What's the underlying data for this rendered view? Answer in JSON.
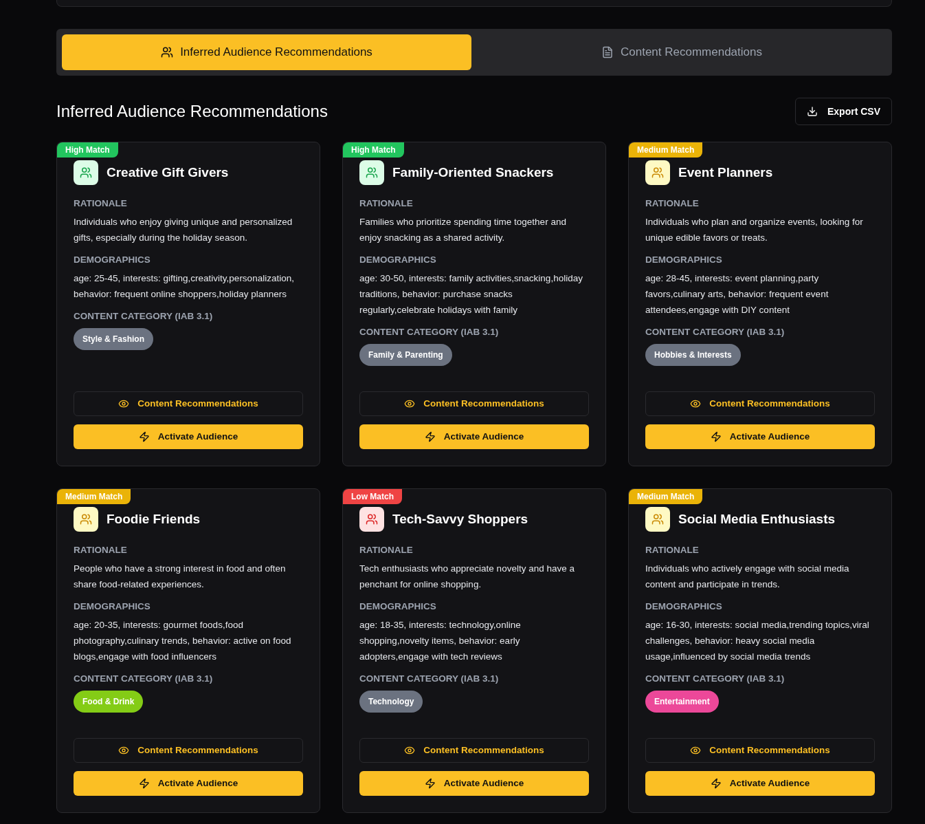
{
  "tabs": [
    {
      "label": "Inferred Audience Recommendations",
      "selected": true
    },
    {
      "label": "Content Recommendations",
      "selected": false
    }
  ],
  "heading": "Inferred Audience Recommendations",
  "export_button": "Export CSV",
  "cards": [
    {
      "kind": "high",
      "badge": "High Match",
      "title": "Creative Gift Givers",
      "labels": [
        "RATIONALE",
        "DEMOGRAPHICS",
        "CONTENT CATEGORY (IAB 3.1)"
      ],
      "rationale": "Individuals who enjoy giving unique and personalized gifts, especially during the holiday season.",
      "demographics": "age: 25-45, interests: gifting,creativity,personalization, behavior: frequent online shoppers,holiday planners",
      "category": {
        "label": "Style & Fashion",
        "color": "#6b7280"
      },
      "content_button": "Content Recommendations",
      "activate_button": "Activate Audience"
    },
    {
      "kind": "high",
      "badge": "High Match",
      "title": "Family-Oriented Snackers",
      "labels": [
        "RATIONALE",
        "DEMOGRAPHICS",
        "CONTENT CATEGORY (IAB 3.1)"
      ],
      "rationale": "Families who prioritize spending time together and enjoy snacking as a shared activity.",
      "demographics": "age: 30-50, interests: family activities,snacking,holiday traditions, behavior: purchase snacks regularly,celebrate holidays with family",
      "category": {
        "label": "Family & Parenting",
        "color": "#6b7280"
      },
      "content_button": "Content Recommendations",
      "activate_button": "Activate Audience"
    },
    {
      "kind": "medium",
      "badge": "Medium Match",
      "title": "Event Planners",
      "labels": [
        "RATIONALE",
        "DEMOGRAPHICS",
        "CONTENT CATEGORY (IAB 3.1)"
      ],
      "rationale": "Individuals who plan and organize events, looking for unique edible favors or treats.",
      "demographics": "age: 28-45, interests: event planning,party favors,culinary arts, behavior: frequent event attendees,engage with DIY content",
      "category": {
        "label": "Hobbies & Interests",
        "color": "#6b7280"
      },
      "content_button": "Content Recommendations",
      "activate_button": "Activate Audience"
    },
    {
      "kind": "medium",
      "badge": "Medium Match",
      "title": "Foodie Friends",
      "labels": [
        "RATIONALE",
        "DEMOGRAPHICS",
        "CONTENT CATEGORY (IAB 3.1)"
      ],
      "rationale": "People who have a strong interest in food and often share food-related experiences.",
      "demographics": "age: 20-35, interests: gourmet foods,food photography,culinary trends, behavior: active on food blogs,engage with food influencers",
      "category": {
        "label": "Food & Drink",
        "color": "#84cc16"
      },
      "content_button": "Content Recommendations",
      "activate_button": "Activate Audience"
    },
    {
      "kind": "low",
      "badge": "Low Match",
      "title": "Tech-Savvy Shoppers",
      "labels": [
        "RATIONALE",
        "DEMOGRAPHICS",
        "CONTENT CATEGORY (IAB 3.1)"
      ],
      "rationale": "Tech enthusiasts who appreciate novelty and have a penchant for online shopping.",
      "demographics": "age: 18-35, interests: technology,online shopping,novelty items, behavior: early adopters,engage with tech reviews",
      "category": {
        "label": "Technology",
        "color": "#6b7280"
      },
      "content_button": "Content Recommendations",
      "activate_button": "Activate Audience"
    },
    {
      "kind": "medium",
      "badge": "Medium Match",
      "title": "Social Media Enthusiasts",
      "labels": [
        "RATIONALE",
        "DEMOGRAPHICS",
        "CONTENT CATEGORY (IAB 3.1)"
      ],
      "rationale": "Individuals who actively engage with social media content and participate in trends.",
      "demographics": "age: 16-30, interests: social media,trending topics,viral challenges, behavior: heavy social media usage,influenced by social media trends",
      "category": {
        "label": "Entertainment",
        "color": "#ec4899"
      },
      "content_button": "Content Recommendations",
      "activate_button": "Activate Audience"
    }
  ]
}
